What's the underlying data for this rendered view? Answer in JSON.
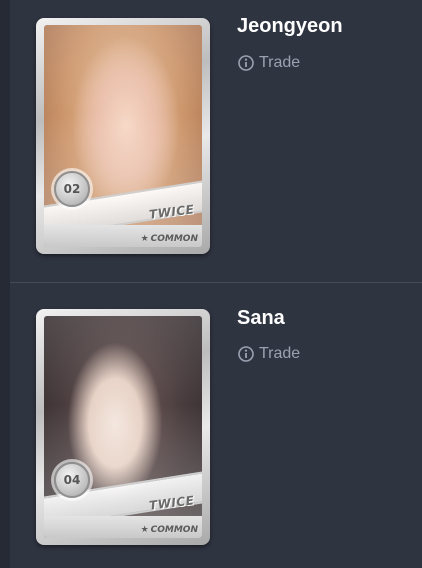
{
  "cards": [
    {
      "name": "Jeongyeon",
      "trade_label": "Trade",
      "card_number": "02",
      "group": "TWICE",
      "rarity": "COMMON",
      "icons": {
        "trade": "info-icon",
        "rarity": "star-icon"
      }
    },
    {
      "name": "Sana",
      "trade_label": "Trade",
      "card_number": "04",
      "group": "TWICE",
      "rarity": "COMMON",
      "icons": {
        "trade": "info-icon",
        "rarity": "star-icon"
      }
    }
  ],
  "colors": {
    "background": "#2f3441",
    "name_text": "#ffffff",
    "trade_text": "#9aa2b1",
    "divider": "#454b59"
  }
}
